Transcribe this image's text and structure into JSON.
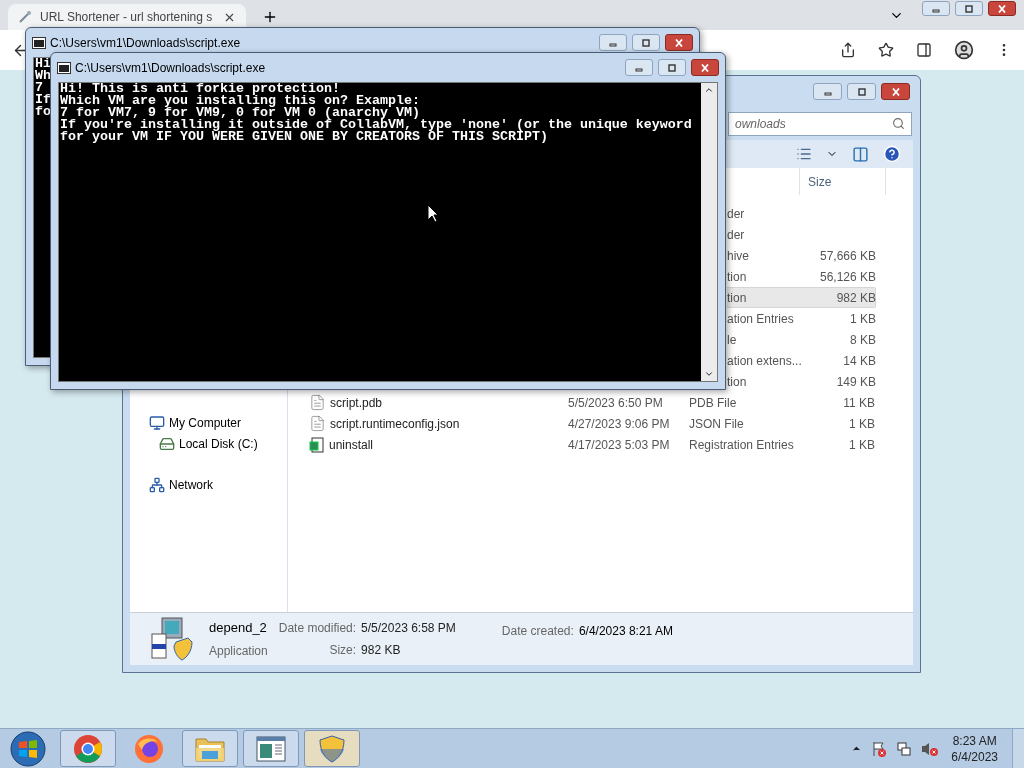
{
  "browser": {
    "tab_title": "URL Shortener - url shortening s"
  },
  "consoles": [
    {
      "title": "C:\\Users\\vm1\\Downloads\\script.exe",
      "lines": [
        "Hi",
        "Wh",
        "7",
        "If",
        "fo"
      ]
    },
    {
      "title": "C:\\Users\\vm1\\Downloads\\script.exe",
      "lines": [
        "Hi! This is anti forkie protection!",
        "Which VM are you installing this on? Example:",
        "7 for VM7, 9 for VM9, 0 for VM 0 (anarchy VM)",
        "If you're installing it outside of CollabVM, type 'none' (or the unique keyword",
        "for your VM IF YOU WERE GIVEN ONE BY CREATORS OF THIS SCRIPT)"
      ]
    }
  ],
  "explorer": {
    "address": "ownloads",
    "columns": [
      {
        "label": "Size"
      }
    ],
    "rows": [
      {
        "type": "der",
        "selected": false
      },
      {
        "type": "der",
        "selected": false
      },
      {
        "type": "hive",
        "size": "57,666 KB",
        "selected": false
      },
      {
        "type": "tion",
        "size": "56,126 KB",
        "selected": false
      },
      {
        "type": "tion",
        "size": "982 KB",
        "selected": true
      },
      {
        "type": "ation Entries",
        "size": "1 KB",
        "selected": false
      },
      {
        "type": "le",
        "size": "8 KB",
        "selected": false
      },
      {
        "type": "ation extens...",
        "size": "14 KB",
        "selected": false
      },
      {
        "type": "tion",
        "size": "149 KB",
        "selected": false
      },
      {
        "kind": "file",
        "name": "script.pdb",
        "date": "5/5/2023 6:50 PM",
        "type": "PDB File",
        "size": "11 KB",
        "selected": false
      },
      {
        "kind": "file",
        "name": "script.runtimeconfig.json",
        "date": "4/27/2023 9:06 PM",
        "type": "JSON File",
        "size": "1 KB",
        "selected": false
      },
      {
        "kind": "reg",
        "name": "uninstall",
        "date": "4/17/2023 5:03 PM",
        "type": "Registration Entries",
        "size": "1 KB",
        "selected": false
      }
    ],
    "nav": [
      {
        "kind": "computer",
        "label": "My Computer",
        "children": [
          {
            "kind": "disk",
            "label": "Local Disk (C:)"
          }
        ]
      },
      {
        "kind": "network",
        "label": "Network"
      }
    ],
    "details": {
      "name": "depend_2",
      "type": "Application",
      "fields": [
        {
          "label": "Date modified:",
          "value": "5/5/2023 6:58 PM"
        },
        {
          "label": "Size:",
          "value": "982 KB"
        },
        {
          "label": "Date created:",
          "value": "6/4/2023 8:21 AM"
        }
      ]
    }
  },
  "taskbar": {
    "apps": [
      {
        "kind": "chrome",
        "open": true,
        "selected": false
      },
      {
        "kind": "firefox",
        "open": false,
        "selected": false
      },
      {
        "kind": "folder",
        "open": true,
        "selected": false
      },
      {
        "kind": "console",
        "open": true,
        "selected": false
      },
      {
        "kind": "shield",
        "open": true,
        "selected": true
      }
    ],
    "time": "8:23 AM",
    "date": "6/4/2023"
  }
}
